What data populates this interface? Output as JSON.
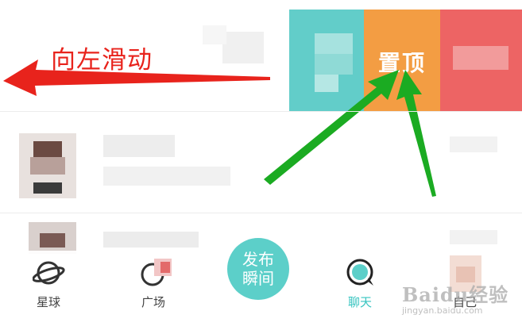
{
  "swipe_actions": {
    "pin_label": "置顶"
  },
  "annotation": {
    "text": "向左滑动",
    "color": "#e8231c",
    "arrow_color": "#1bab22"
  },
  "bottom_nav": {
    "items": [
      {
        "label": "星球",
        "icon": "planet-icon"
      },
      {
        "label": "广场",
        "icon": "square-icon"
      },
      {
        "label": "聊天",
        "icon": "chat-bubble-icon",
        "active": true
      },
      {
        "label": "自己",
        "icon": "avatar"
      }
    ],
    "publish": {
      "line1": "发布",
      "line2": "瞬间"
    },
    "active_color": "#37c4c0"
  },
  "watermark": {
    "main": "Baidu经验",
    "sub": "jingyan.baidu.com"
  },
  "colors": {
    "teal": "#62cdc9",
    "orange": "#f39d43",
    "red": "#ed6464"
  }
}
